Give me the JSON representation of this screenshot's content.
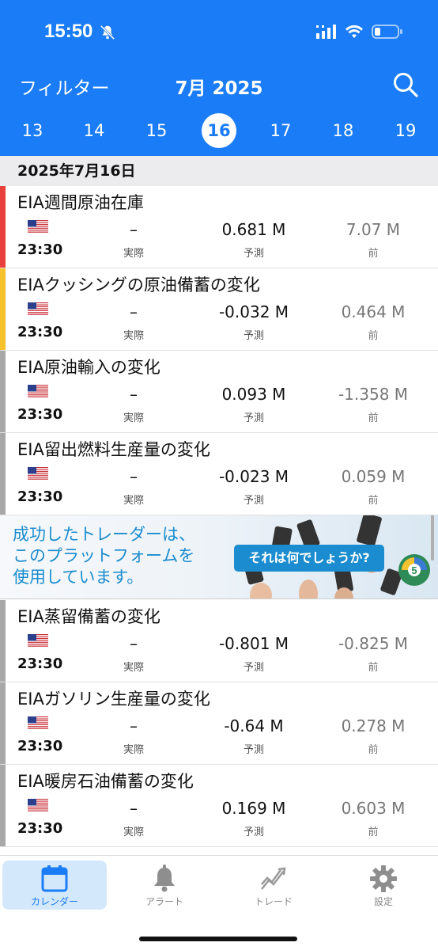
{
  "status_bar": {
    "time": "15:50"
  },
  "header": {
    "filter_label": "フィルター",
    "month_title": "7月 2025",
    "days": [
      "13",
      "14",
      "15",
      "16",
      "17",
      "18",
      "19"
    ],
    "selected_day": "16",
    "accent_color": "#1a7cf6"
  },
  "date_header": "2025年7月16日",
  "labels": {
    "actual": "実際",
    "forecast": "予測",
    "previous": "前"
  },
  "events": [
    {
      "title": "EIA週間原油在庫",
      "time": "23:30",
      "actual": "–",
      "forecast": "0.681 M",
      "previous": "7.07 M",
      "impact_color": "#e8403b"
    },
    {
      "title": "EIAクッシングの原油備蓄の変化",
      "time": "23:30",
      "actual": "–",
      "forecast": "-0.032 M",
      "previous": "0.464 M",
      "impact_color": "#f7c22b"
    },
    {
      "title": "EIA原油輸入の変化",
      "time": "23:30",
      "actual": "–",
      "forecast": "0.093 M",
      "previous": "-1.358 M",
      "impact_color": "#a8a8a8"
    },
    {
      "title": "EIA留出燃料生産量の変化",
      "time": "23:30",
      "actual": "–",
      "forecast": "-0.023 M",
      "previous": "0.059 M",
      "impact_color": "#a8a8a8"
    },
    {
      "title": "EIA蒸留備蓄の変化",
      "time": "23:30",
      "actual": "–",
      "forecast": "-0.801 M",
      "previous": "-0.825 M",
      "impact_color": "#a8a8a8"
    },
    {
      "title": "EIAガソリン生産量の変化",
      "time": "23:30",
      "actual": "–",
      "forecast": "-0.64 M",
      "previous": "0.278 M",
      "impact_color": "#a8a8a8"
    },
    {
      "title": "EIA暖房石油備蓄の変化",
      "time": "23:30",
      "actual": "–",
      "forecast": "0.169 M",
      "previous": "0.603 M",
      "impact_color": "#a8a8a8"
    }
  ],
  "ad": {
    "text": "成功したトレーダーは、このプラットフォームを使用しています。",
    "cta": "それは何でしょうか?"
  },
  "tabs": [
    {
      "label": "カレンダー",
      "icon": "calendar-icon",
      "active": true
    },
    {
      "label": "アラート",
      "icon": "bell-icon",
      "active": false
    },
    {
      "label": "トレード",
      "icon": "trade-icon",
      "active": false
    },
    {
      "label": "設定",
      "icon": "gear-icon",
      "active": false
    }
  ]
}
